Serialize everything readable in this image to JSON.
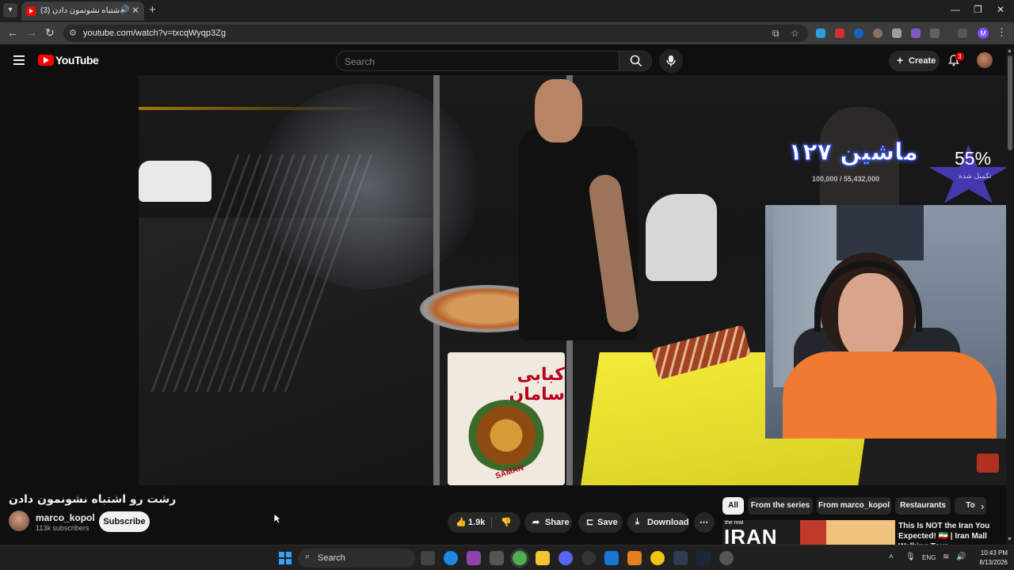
{
  "browser": {
    "tab_title": "(3) رشت رو اشتباه نشونمون دادن",
    "url": "youtube.com/watch?v=txcqWyqp3Zg"
  },
  "youtube": {
    "brand": "YouTube",
    "search_placeholder": "Search",
    "create_label": "Create",
    "notification_count": "3"
  },
  "overlay": {
    "goal_title": "ماشین ۱۲۷",
    "goal_sub": "100,000 / 55,432,000",
    "goal_percent": "55%",
    "goal_percent_sub": "تکمیل شده"
  },
  "video": {
    "title": "رشت رو اشتباه نشونمون دادن",
    "sign_text": "کبابی سامان",
    "sign_brand": "SAMAN",
    "channel_name": "marco_kopol",
    "channel_subs": "113k subscribers",
    "subscribe_label": "Subscribe",
    "like_count": "1.9k",
    "share_label": "Share",
    "save_label": "Save",
    "download_label": "Download"
  },
  "chips": [
    "All",
    "From the series",
    "From marco_kopol",
    "Restaurants",
    "To"
  ],
  "recommendation": {
    "thumb_small": "the real",
    "thumb_big": "IRAN",
    "title": "This Is NOT the Iran You Expected! 🇮🇷 | Iran Mall Walking Tour"
  },
  "taskbar": {
    "search_label": "Search",
    "lang": "ENG",
    "time": "10:43 PM",
    "date": "8/13/2026"
  },
  "colors": {
    "yt_red": "#ff0000",
    "bg": "#0f0f0f",
    "chip_bg": "#272727",
    "taskbar_bg": "#202020"
  }
}
